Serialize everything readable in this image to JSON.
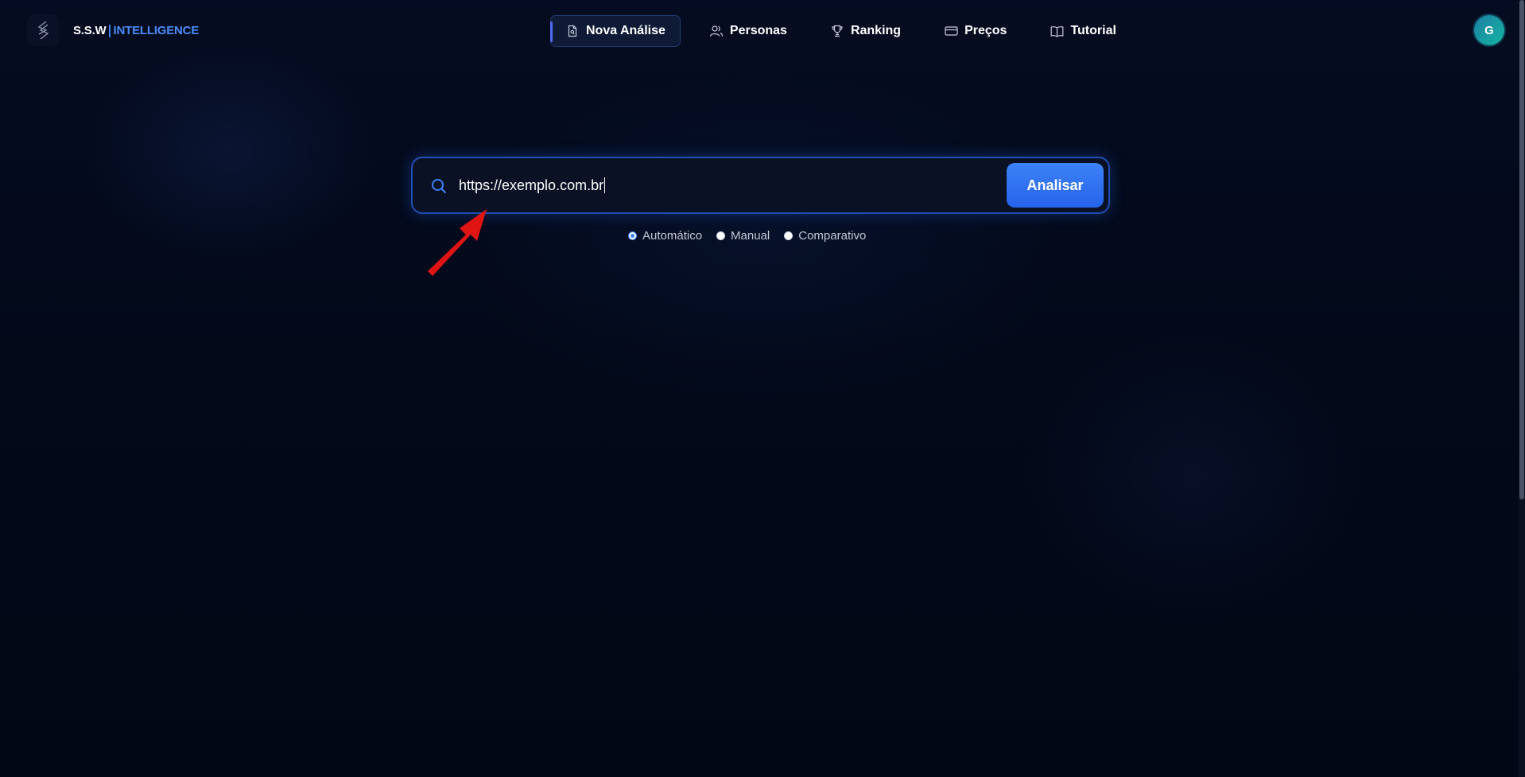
{
  "brand": {
    "name_part1": "S.S.W",
    "name_part2": "INTELLIGENCE"
  },
  "nav": {
    "items": [
      {
        "label": "Nova Análise",
        "icon": "file-search-icon",
        "active": true
      },
      {
        "label": "Personas",
        "icon": "users-icon",
        "active": false
      },
      {
        "label": "Ranking",
        "icon": "trophy-icon",
        "active": false
      },
      {
        "label": "Preços",
        "icon": "credit-card-icon",
        "active": false
      },
      {
        "label": "Tutorial",
        "icon": "book-open-icon",
        "active": false
      }
    ]
  },
  "user": {
    "avatar_initial": "G"
  },
  "search": {
    "value": "https://exemplo.com.br",
    "submit_label": "Analisar",
    "icon": "search-icon"
  },
  "modes": {
    "options": [
      "Automático",
      "Manual",
      "Comparativo"
    ],
    "selected": "Automático"
  },
  "colors": {
    "accent": "#3b82f6",
    "brand_secondary": "#4b8df8",
    "background": "#020716",
    "annotation_arrow": "#e11414"
  }
}
